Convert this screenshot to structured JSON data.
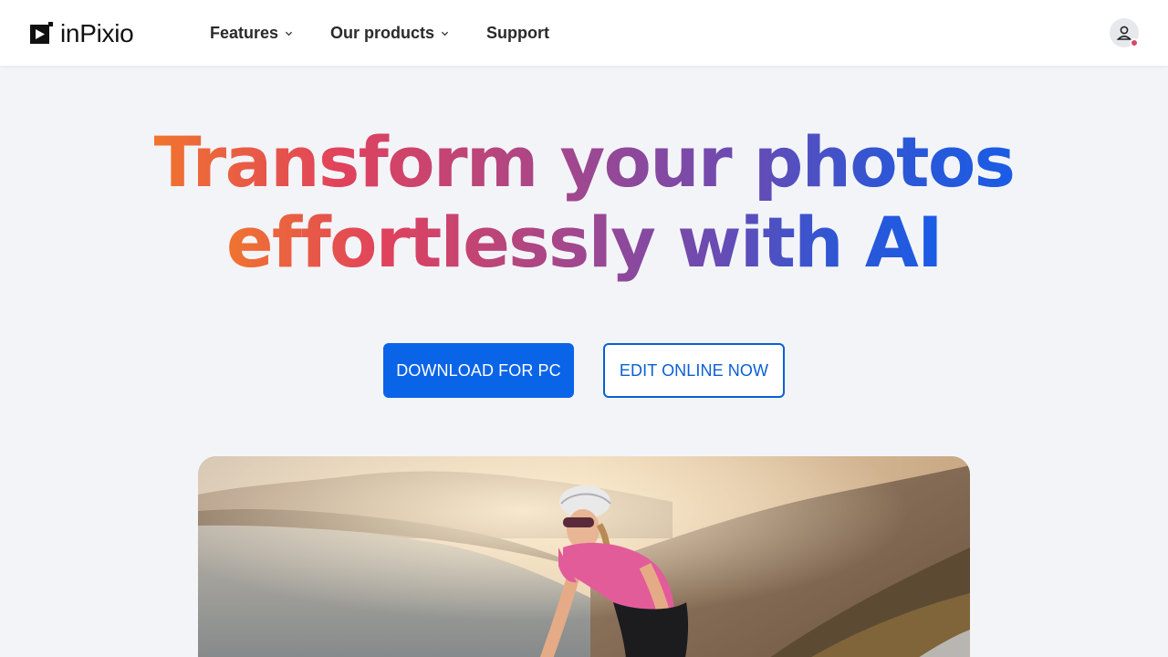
{
  "header": {
    "logo_text": "inPixio",
    "nav": [
      {
        "label": "Features",
        "has_dropdown": true
      },
      {
        "label": "Our products",
        "has_dropdown": true
      },
      {
        "label": "Support",
        "has_dropdown": false
      }
    ],
    "account_icon": "user-icon",
    "notification_color": "#d54b66"
  },
  "hero": {
    "title_line1": "Transform your photos",
    "title_line2": "effortlessly with AI",
    "gradient_colors": [
      "#f0742f",
      "#e0425c",
      "#a3478d",
      "#6b4bb2",
      "#2f56d4"
    ],
    "primary_button": "DOWNLOAD FOR PC",
    "secondary_button": "EDIT ONLINE NOW",
    "accent": "#0a64e8"
  },
  "image": {
    "icons": [
      "cyclist-photo"
    ]
  }
}
